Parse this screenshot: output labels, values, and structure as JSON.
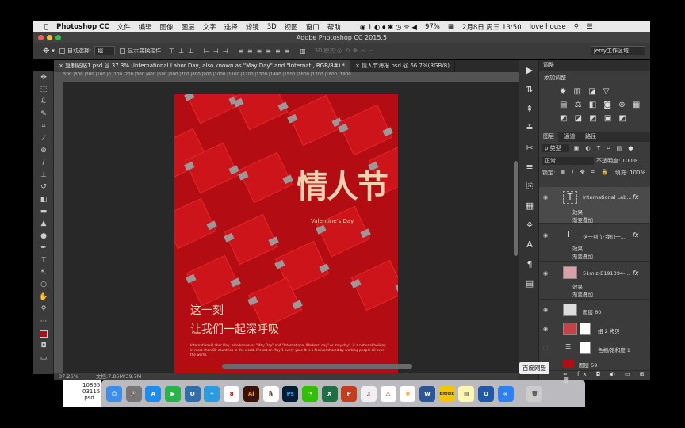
{
  "menubar": {
    "app": "Photoshop CC",
    "items": [
      "文件",
      "编辑",
      "图像",
      "图层",
      "文字",
      "选择",
      "滤镜",
      "3D",
      "视图",
      "窗口",
      "帮助"
    ],
    "battery": "97%",
    "datetime": "2月8日 周三  13:50",
    "user": "love house"
  },
  "window": {
    "title": "Adobe Photoshop CC 2015.5"
  },
  "options": {
    "auto_select": "自动选择:",
    "group_value": "组",
    "show_transform": "显示变换控件",
    "mode_3d": "3D 模式:",
    "workspace": "jerry工作区域"
  },
  "tabs": [
    {
      "label": "复制贴贴1.psd @ 37.3% (International Labor Day, also known as \"May Day\" and \"Internati, RGB/8#) *"
    },
    {
      "label": "情人节海报.psd @ 66.7%(RGB/8)"
    }
  ],
  "ruler": {
    "ticks": "500  |300  |200  |100  |0  |100  |200  |300  |400  |500  |600  |700  |800  |900  |1000  |1100  |1200  |1300  |1400  |1500  |1600  |1700  |1800  |1900"
  },
  "poster": {
    "title": "情人节",
    "subtitle": "Valentine's Day",
    "line1": "这一刻",
    "line2": "让我们一起深呼吸",
    "body": "International Labor Day, also known as \"May Day\" and \"International Workers' day\" or may day\", is a national holiday in more than 80 countries in the world. It's set on May 1 every year. It is a festival shared by working people all over the world."
  },
  "status": {
    "zoom": "37.26%",
    "doc": "文档:7.85M/39.7M"
  },
  "adjust": {
    "tab": "调整",
    "add": "添加调整"
  },
  "layers": {
    "tabs": [
      "图层",
      "通道",
      "路径"
    ],
    "kind": "ρ 类型",
    "blend": "正常",
    "opacity_label": "不透明度:",
    "opacity": "100%",
    "lock": "锁定:",
    "fill_label": "填充:",
    "fill": "100%",
    "items": [
      {
        "name": "International Lab...",
        "fx": "fx",
        "effects": "效果",
        "effect": "渐变叠加"
      },
      {
        "name": "这一刻 让我们一...",
        "fx": "fx",
        "effects": "效果",
        "effect": "渐变叠加"
      },
      {
        "name": "51miz-E191394-...",
        "fx": "fx",
        "effects": "效果",
        "effect": "渐变叠加"
      },
      {
        "name": "图层 60"
      },
      {
        "name": "组 2 拷贝"
      },
      {
        "name": "色相/饱和度 1"
      },
      {
        "name": "图层 59"
      }
    ]
  },
  "tooltip": "百度网盘",
  "desktop": {
    "lines": [
      "10865",
      "03115",
      ".psd"
    ]
  },
  "dock": [
    "Finder",
    "Launchpad",
    "App Store",
    "FaceTime",
    "QuickTime",
    "Safari",
    "日历",
    "Ai",
    "QQ",
    "Ps",
    "微信",
    "Excel",
    "PPT",
    "iTunes",
    "PDF",
    "Photos",
    "Word",
    "Bitfolk",
    "备忘录",
    "QQ浏览器",
    "百度网盘",
    "废纸篓"
  ],
  "colors": {
    "poster_bg": "#b30c12",
    "title": "#f2d2b0",
    "ui": "#3b3b3b"
  }
}
